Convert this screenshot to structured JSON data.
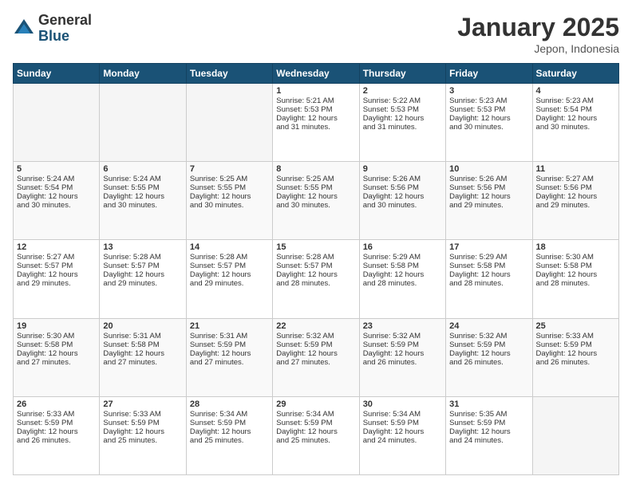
{
  "logo": {
    "general": "General",
    "blue": "Blue"
  },
  "title": "January 2025",
  "location": "Jepon, Indonesia",
  "days": [
    "Sunday",
    "Monday",
    "Tuesday",
    "Wednesday",
    "Thursday",
    "Friday",
    "Saturday"
  ],
  "weeks": [
    [
      {
        "day": "",
        "info": ""
      },
      {
        "day": "",
        "info": ""
      },
      {
        "day": "",
        "info": ""
      },
      {
        "day": "1",
        "info": "Sunrise: 5:21 AM\nSunset: 5:53 PM\nDaylight: 12 hours\nand 31 minutes."
      },
      {
        "day": "2",
        "info": "Sunrise: 5:22 AM\nSunset: 5:53 PM\nDaylight: 12 hours\nand 31 minutes."
      },
      {
        "day": "3",
        "info": "Sunrise: 5:23 AM\nSunset: 5:53 PM\nDaylight: 12 hours\nand 30 minutes."
      },
      {
        "day": "4",
        "info": "Sunrise: 5:23 AM\nSunset: 5:54 PM\nDaylight: 12 hours\nand 30 minutes."
      }
    ],
    [
      {
        "day": "5",
        "info": "Sunrise: 5:24 AM\nSunset: 5:54 PM\nDaylight: 12 hours\nand 30 minutes."
      },
      {
        "day": "6",
        "info": "Sunrise: 5:24 AM\nSunset: 5:55 PM\nDaylight: 12 hours\nand 30 minutes."
      },
      {
        "day": "7",
        "info": "Sunrise: 5:25 AM\nSunset: 5:55 PM\nDaylight: 12 hours\nand 30 minutes."
      },
      {
        "day": "8",
        "info": "Sunrise: 5:25 AM\nSunset: 5:55 PM\nDaylight: 12 hours\nand 30 minutes."
      },
      {
        "day": "9",
        "info": "Sunrise: 5:26 AM\nSunset: 5:56 PM\nDaylight: 12 hours\nand 30 minutes."
      },
      {
        "day": "10",
        "info": "Sunrise: 5:26 AM\nSunset: 5:56 PM\nDaylight: 12 hours\nand 29 minutes."
      },
      {
        "day": "11",
        "info": "Sunrise: 5:27 AM\nSunset: 5:56 PM\nDaylight: 12 hours\nand 29 minutes."
      }
    ],
    [
      {
        "day": "12",
        "info": "Sunrise: 5:27 AM\nSunset: 5:57 PM\nDaylight: 12 hours\nand 29 minutes."
      },
      {
        "day": "13",
        "info": "Sunrise: 5:28 AM\nSunset: 5:57 PM\nDaylight: 12 hours\nand 29 minutes."
      },
      {
        "day": "14",
        "info": "Sunrise: 5:28 AM\nSunset: 5:57 PM\nDaylight: 12 hours\nand 29 minutes."
      },
      {
        "day": "15",
        "info": "Sunrise: 5:28 AM\nSunset: 5:57 PM\nDaylight: 12 hours\nand 28 minutes."
      },
      {
        "day": "16",
        "info": "Sunrise: 5:29 AM\nSunset: 5:58 PM\nDaylight: 12 hours\nand 28 minutes."
      },
      {
        "day": "17",
        "info": "Sunrise: 5:29 AM\nSunset: 5:58 PM\nDaylight: 12 hours\nand 28 minutes."
      },
      {
        "day": "18",
        "info": "Sunrise: 5:30 AM\nSunset: 5:58 PM\nDaylight: 12 hours\nand 28 minutes."
      }
    ],
    [
      {
        "day": "19",
        "info": "Sunrise: 5:30 AM\nSunset: 5:58 PM\nDaylight: 12 hours\nand 27 minutes."
      },
      {
        "day": "20",
        "info": "Sunrise: 5:31 AM\nSunset: 5:58 PM\nDaylight: 12 hours\nand 27 minutes."
      },
      {
        "day": "21",
        "info": "Sunrise: 5:31 AM\nSunset: 5:59 PM\nDaylight: 12 hours\nand 27 minutes."
      },
      {
        "day": "22",
        "info": "Sunrise: 5:32 AM\nSunset: 5:59 PM\nDaylight: 12 hours\nand 27 minutes."
      },
      {
        "day": "23",
        "info": "Sunrise: 5:32 AM\nSunset: 5:59 PM\nDaylight: 12 hours\nand 26 minutes."
      },
      {
        "day": "24",
        "info": "Sunrise: 5:32 AM\nSunset: 5:59 PM\nDaylight: 12 hours\nand 26 minutes."
      },
      {
        "day": "25",
        "info": "Sunrise: 5:33 AM\nSunset: 5:59 PM\nDaylight: 12 hours\nand 26 minutes."
      }
    ],
    [
      {
        "day": "26",
        "info": "Sunrise: 5:33 AM\nSunset: 5:59 PM\nDaylight: 12 hours\nand 26 minutes."
      },
      {
        "day": "27",
        "info": "Sunrise: 5:33 AM\nSunset: 5:59 PM\nDaylight: 12 hours\nand 25 minutes."
      },
      {
        "day": "28",
        "info": "Sunrise: 5:34 AM\nSunset: 5:59 PM\nDaylight: 12 hours\nand 25 minutes."
      },
      {
        "day": "29",
        "info": "Sunrise: 5:34 AM\nSunset: 5:59 PM\nDaylight: 12 hours\nand 25 minutes."
      },
      {
        "day": "30",
        "info": "Sunrise: 5:34 AM\nSunset: 5:59 PM\nDaylight: 12 hours\nand 24 minutes."
      },
      {
        "day": "31",
        "info": "Sunrise: 5:35 AM\nSunset: 5:59 PM\nDaylight: 12 hours\nand 24 minutes."
      },
      {
        "day": "",
        "info": ""
      }
    ]
  ]
}
